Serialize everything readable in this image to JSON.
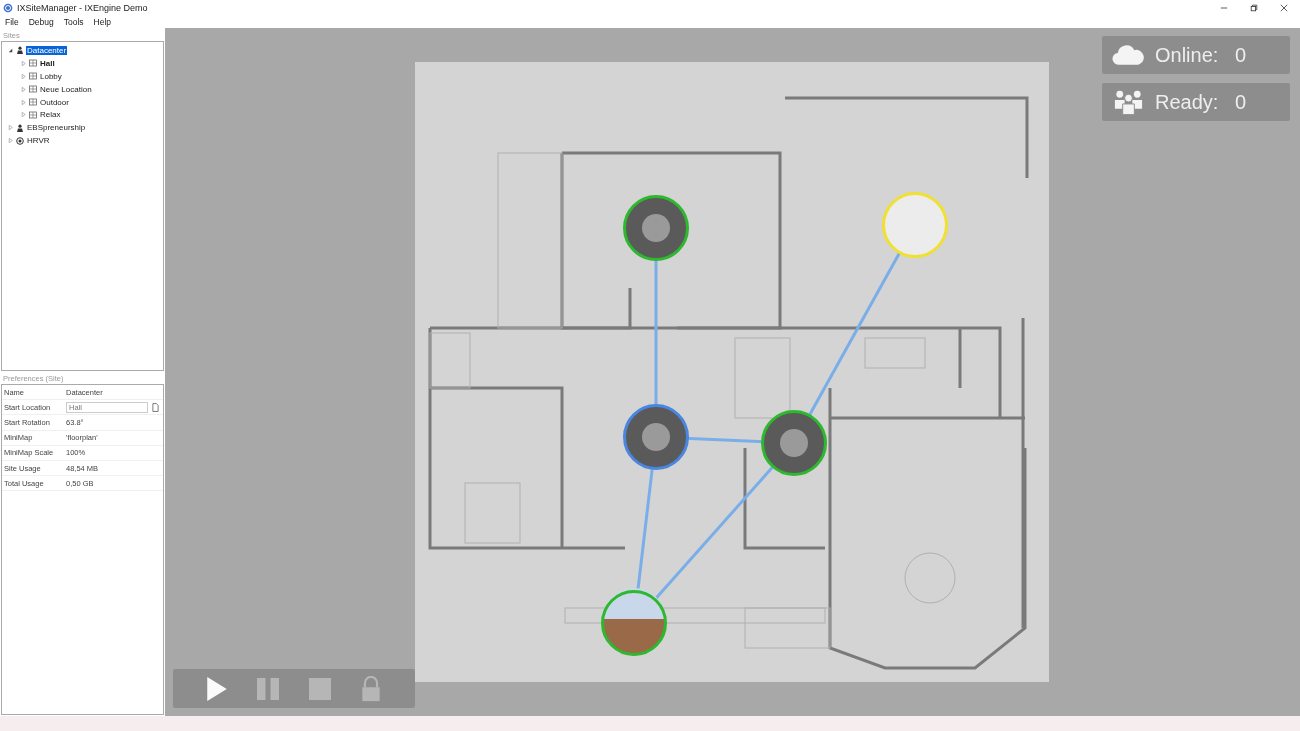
{
  "window": {
    "title": "IXSiteManager - IXEngine Demo"
  },
  "menu": [
    "File",
    "Debug",
    "Tools",
    "Help"
  ],
  "sites": {
    "title": "Sites",
    "tree": [
      {
        "label": "Datacenter",
        "kind": "site",
        "selected": true,
        "expanded": true,
        "start": false,
        "children": [
          {
            "label": "Hall",
            "kind": "location",
            "selected": false,
            "expanded": false,
            "start": true
          },
          {
            "label": "Lobby",
            "kind": "location",
            "selected": false,
            "expanded": false,
            "start": false
          },
          {
            "label": "Neue Location",
            "kind": "location",
            "selected": false,
            "expanded": false,
            "start": false
          },
          {
            "label": "Outdoor",
            "kind": "location",
            "selected": false,
            "expanded": false,
            "start": false
          },
          {
            "label": "Relax",
            "kind": "location",
            "selected": false,
            "expanded": false,
            "start": false
          }
        ]
      },
      {
        "label": "EBSpreneurship",
        "kind": "site",
        "selected": false,
        "expanded": false,
        "start": false
      },
      {
        "label": "HRVR",
        "kind": "target",
        "selected": false,
        "expanded": false,
        "start": false
      }
    ]
  },
  "preferences": {
    "title": "Preferences (Site)",
    "rows": [
      {
        "name": "Name",
        "value": "Datacenter",
        "kind": "text"
      },
      {
        "name": "Start Location",
        "value": "Hall",
        "kind": "field"
      },
      {
        "name": "Start Rotation",
        "value": "63.8°",
        "kind": "text"
      },
      {
        "name": "MiniMap",
        "value": "'floorplan'",
        "kind": "text"
      },
      {
        "name": "MiniMap Scale",
        "value": "100%",
        "kind": "text"
      },
      {
        "name": "Site Usage",
        "value": "48,54 MB",
        "kind": "text"
      },
      {
        "name": "Total Usage",
        "value": "0,50 GB",
        "kind": "text"
      }
    ]
  },
  "status": [
    {
      "kind": "online",
      "label": "Online:",
      "count": "0"
    },
    {
      "kind": "ready",
      "label": "Ready:",
      "count": "0"
    }
  ],
  "map": {
    "nodes": [
      {
        "color": "#2db82d",
        "kind": "indoor"
      },
      {
        "color": "#f0e030",
        "kind": "blank"
      },
      {
        "color": "#4a86e0",
        "kind": "indoor"
      },
      {
        "color": "#2db82d",
        "kind": "indoor"
      },
      {
        "color": "#2db82d",
        "kind": "outdoor"
      }
    ]
  },
  "controls": [
    {
      "kind": "play"
    },
    {
      "kind": "pause"
    },
    {
      "kind": "stop"
    },
    {
      "kind": "lock"
    }
  ]
}
